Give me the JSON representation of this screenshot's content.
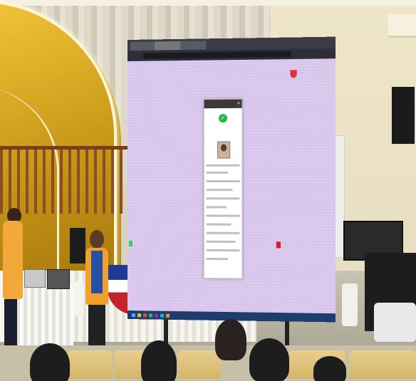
{
  "scene": {
    "description_free": true
  },
  "screen": {
    "browser_tabs": [
      "",
      "",
      ""
    ],
    "address": "",
    "site_logo": "",
    "header_link": "",
    "header_login": "",
    "nav_items": [
      "",
      "",
      "",
      "",
      "",
      ""
    ],
    "modal_title": "",
    "verify_text": ""
  },
  "colors": {
    "screen_background": "#d7c5ec",
    "check_icon": "#2bb34a",
    "taskbar": "#1f3c6e",
    "red_marker": "#e0182a",
    "green_marker": "#2bd45a"
  },
  "icons": {
    "check": "check-icon",
    "close": "close-icon",
    "seal": "seal-icon"
  }
}
